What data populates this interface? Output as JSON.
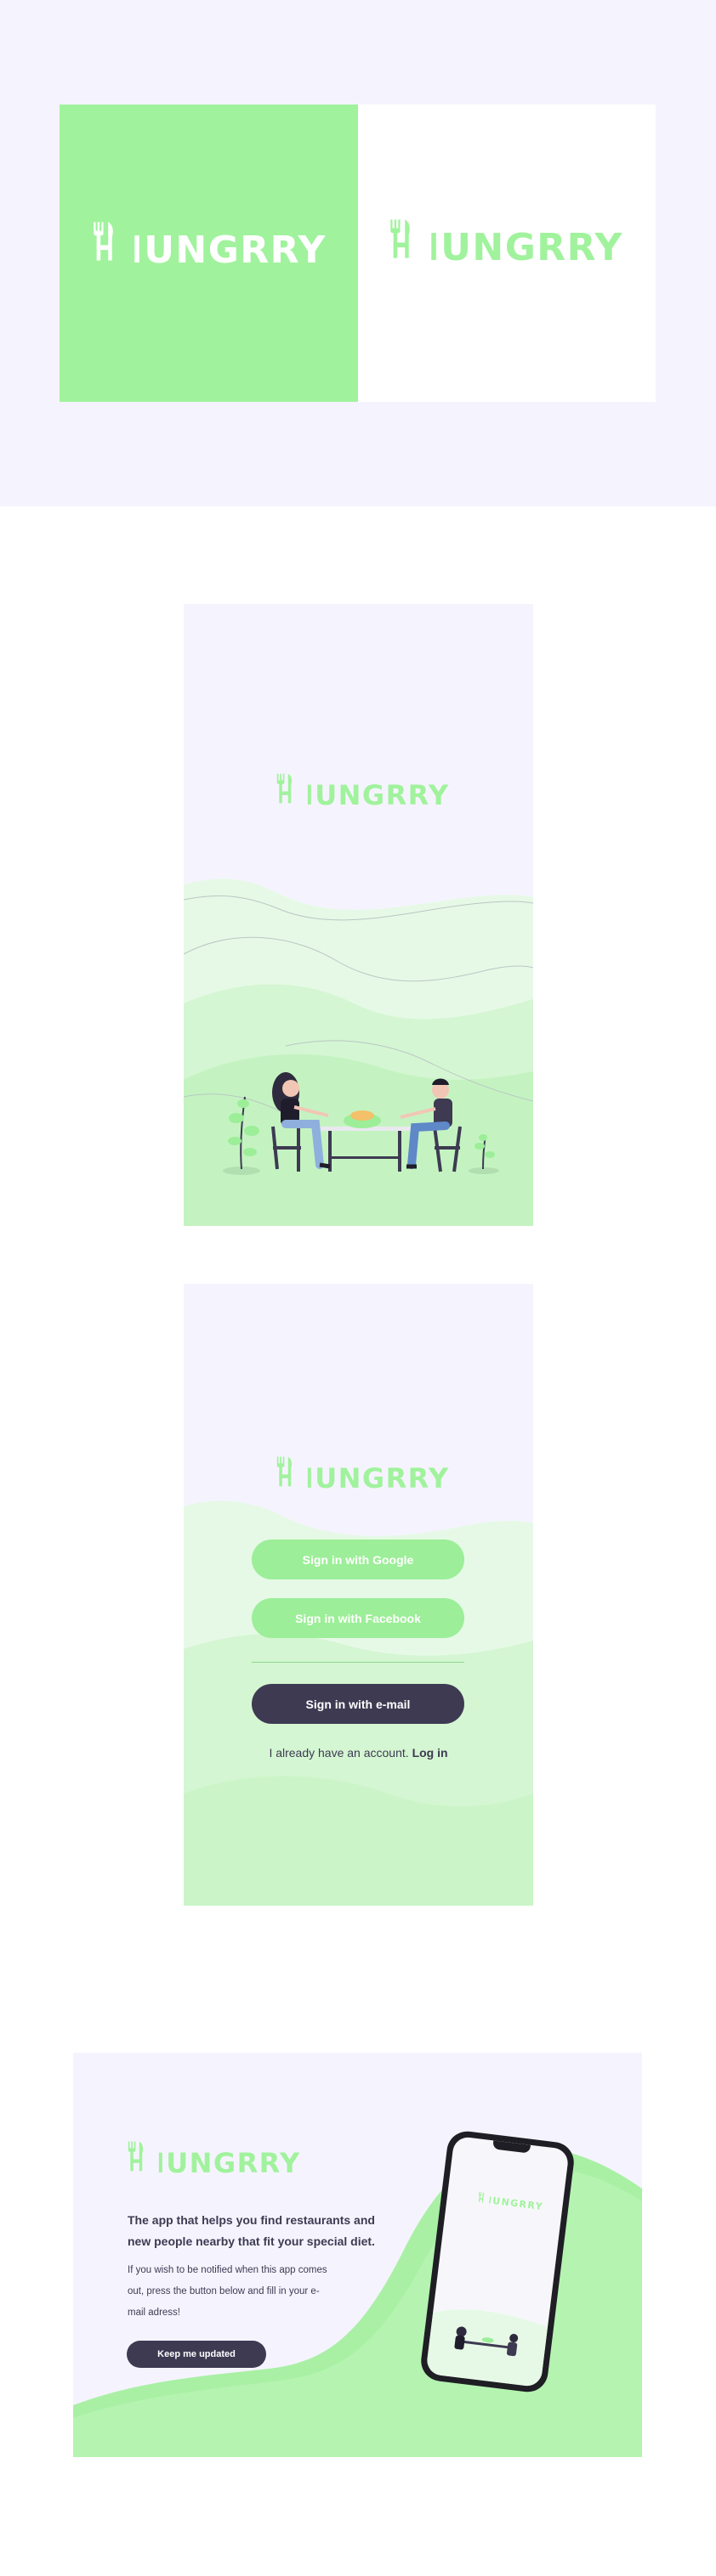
{
  "brand": {
    "name": "HUNGRRY",
    "primary_green": "#a1f29d",
    "dark": "#3d3a52",
    "background": "#f5f4fe",
    "logo_icon": "fork-knife-icon"
  },
  "signin": {
    "google_label": "Sign in with Google",
    "facebook_label": "Sign in with Facebook",
    "email_label": "Sign in with e-mail",
    "account_text": "I already have an account.",
    "login_link": "Log in"
  },
  "landing": {
    "headline": "The app that helps you find restaurants and new people nearby that fit your special diet.",
    "body": "If you wish to be notified when this app comes out, press the button below and fill in your e-mail adress!",
    "cta_label": "Keep me updated"
  }
}
